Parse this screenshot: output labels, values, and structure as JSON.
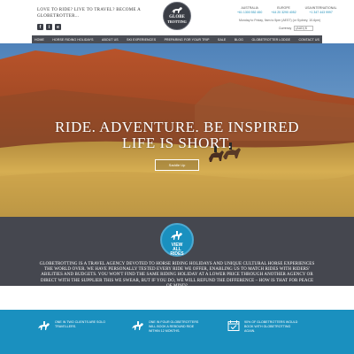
{
  "header": {
    "tagline": "Love to ride? Live to travel? Become a Globetrotter...",
    "social": [
      "f",
      "i",
      "e"
    ],
    "logo_text_1": "GLOBE",
    "logo_text_2": "TROTTING",
    "offices": [
      {
        "name": "AUSTRALIA",
        "phone": "+61 1300 552 450"
      },
      {
        "name": "EUROPE",
        "phone": "+44 20 3290 4052"
      },
      {
        "name": "USA/INTERNATIONAL",
        "phone": "+1 347 443 9997"
      }
    ],
    "hours": "Monday to Friday, 9am to 5pm (AEST) (or Sydney, 10-6pm)",
    "currency_label": "Currency",
    "currency_value": "(AUD) $"
  },
  "nav": {
    "items": [
      "Home",
      "Horse Riding Holidays",
      "About Us",
      "Ski Experiences",
      "Preparing for your Trip",
      "Sale",
      "Blog",
      "Globetrotter Lodge",
      "Contact Us"
    ]
  },
  "hero": {
    "title_line1": "RIDE. ADVENTURE. BE INSPIRED",
    "title_line2": "LIFE IS SHORT.",
    "button_label": "Saddle Up"
  },
  "about": {
    "circle_line1": "VIEW",
    "circle_line2": "ALL",
    "circle_line3": "RIDES",
    "text": "Globetrotting is a travel agency devoted to horse riding holidays and unique cultural horse experiences the world over. We have personally tested every ride we offer, enabling us to match rides with riders' abilities and budgets. You won't find the same riding holiday at a lower price through another agency or direct with the supplier this we swear, but if you do, we will refund the difference – how is that for peace of mind?"
  },
  "stats": [
    {
      "icon": "horse-rider-icon",
      "text": "One in two clients are solo travellers."
    },
    {
      "icon": "horse-rider-icon",
      "text": "One in four Globetrotters will book a rebound ride within 12 months."
    },
    {
      "icon": "calendar-icon",
      "text": "90% of Globetrotters would book with Globetrotting again."
    }
  ],
  "colors": {
    "accent_blue": "#1a90bf",
    "dark_gray": "#45474f",
    "nav_gray": "#4a4d55"
  }
}
